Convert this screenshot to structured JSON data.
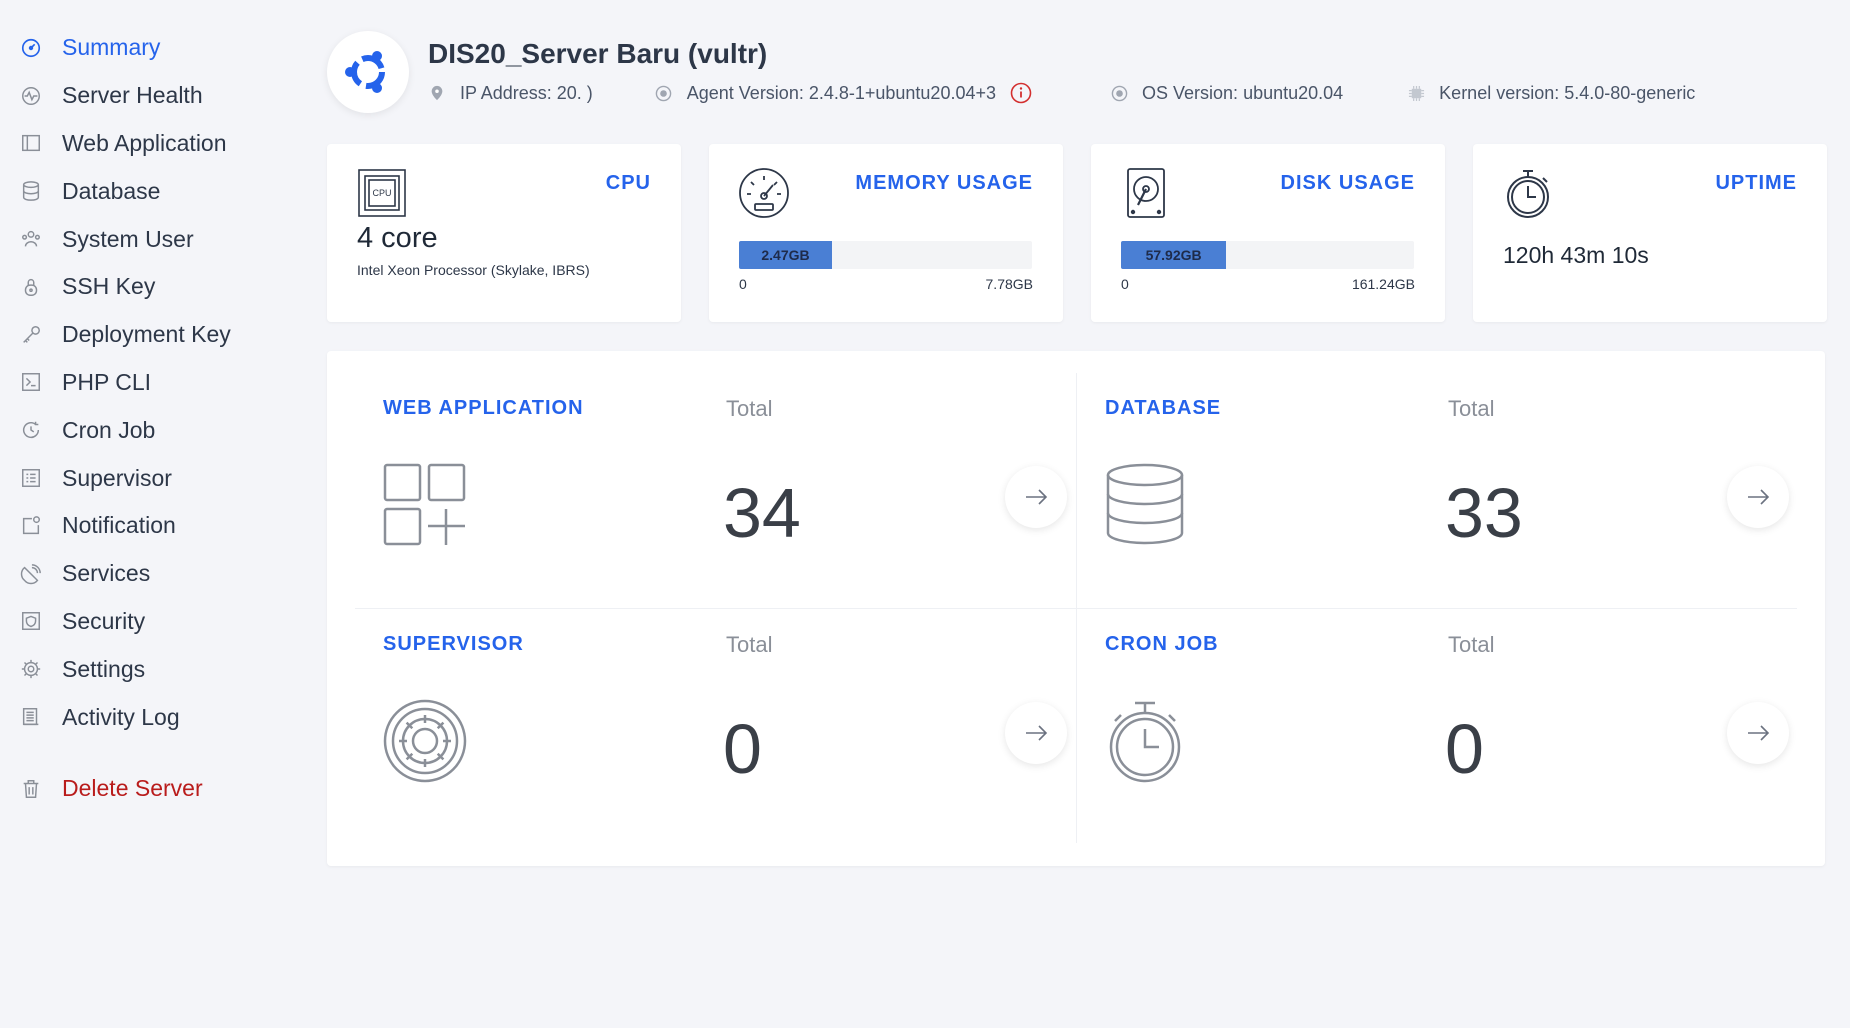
{
  "sidebar": {
    "items": [
      {
        "label": "Summary"
      },
      {
        "label": "Server Health"
      },
      {
        "label": "Web Application"
      },
      {
        "label": "Database"
      },
      {
        "label": "System User"
      },
      {
        "label": "SSH Key"
      },
      {
        "label": "Deployment Key"
      },
      {
        "label": "PHP CLI"
      },
      {
        "label": "Cron Job"
      },
      {
        "label": "Supervisor"
      },
      {
        "label": "Notification"
      },
      {
        "label": "Services"
      },
      {
        "label": "Security"
      },
      {
        "label": "Settings"
      },
      {
        "label": "Activity Log"
      }
    ],
    "delete_label": "Delete Server"
  },
  "header": {
    "title": "DIS20_Server Baru (vultr)",
    "ip_label": "IP Address: 20.         )",
    "agent_version": "Agent Version: 2.4.8-1+ubuntu20.04+3",
    "os_version": "OS Version: ubuntu20.04",
    "kernel_version": "Kernel version: 5.4.0-80-generic"
  },
  "stats": {
    "cpu": {
      "title": "CPU",
      "cores": "4 core",
      "model": "Intel Xeon Processor (Skylake, IBRS)",
      "chip_text": "CPU"
    },
    "memory": {
      "title": "MEMORY USAGE",
      "used": "2.47GB",
      "min": "0",
      "max": "7.78GB",
      "fraction": 0.3175
    },
    "disk": {
      "title": "DISK USAGE",
      "used": "57.92GB",
      "min": "0",
      "max": "161.24GB",
      "fraction": 0.3592
    },
    "uptime": {
      "title": "UPTIME",
      "value": "120h 43m 10s"
    }
  },
  "summary": {
    "web_application": {
      "title": "WEB APPLICATION",
      "total_label": "Total",
      "count": "34"
    },
    "database": {
      "title": "DATABASE",
      "total_label": "Total",
      "count": "33"
    },
    "supervisor": {
      "title": "SUPERVISOR",
      "total_label": "Total",
      "count": "0"
    },
    "cron_job": {
      "title": "CRON JOB",
      "total_label": "Total",
      "count": "0"
    }
  },
  "colors": {
    "accent": "#2563eb",
    "danger": "#b91c1c",
    "bar": "#4a7fd4",
    "background": "#f4f5f9"
  }
}
